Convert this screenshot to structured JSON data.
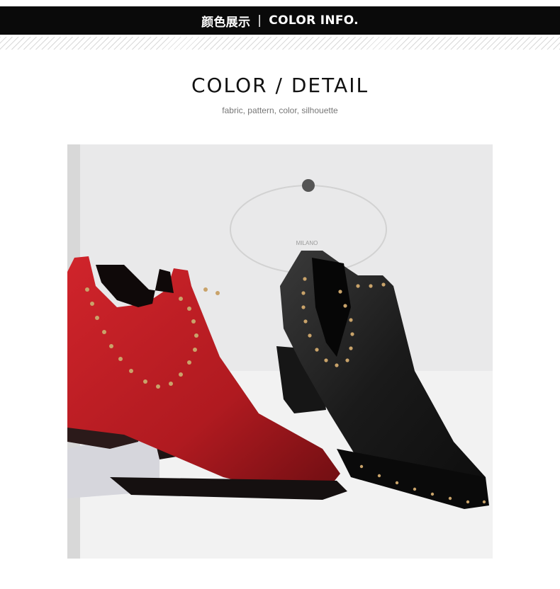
{
  "header": {
    "cn_label": "颜色展示",
    "separator": "|",
    "en_label": "COLOR INFO."
  },
  "section": {
    "title": "COLOR / DETAIL",
    "subtitle": "fabric, pattern, color, silhouette"
  },
  "photo": {
    "box_text": "MILANO",
    "boot_colors": {
      "red": "#b81c22",
      "black": "#1a1a1a",
      "stud": "#c9a36a"
    }
  }
}
